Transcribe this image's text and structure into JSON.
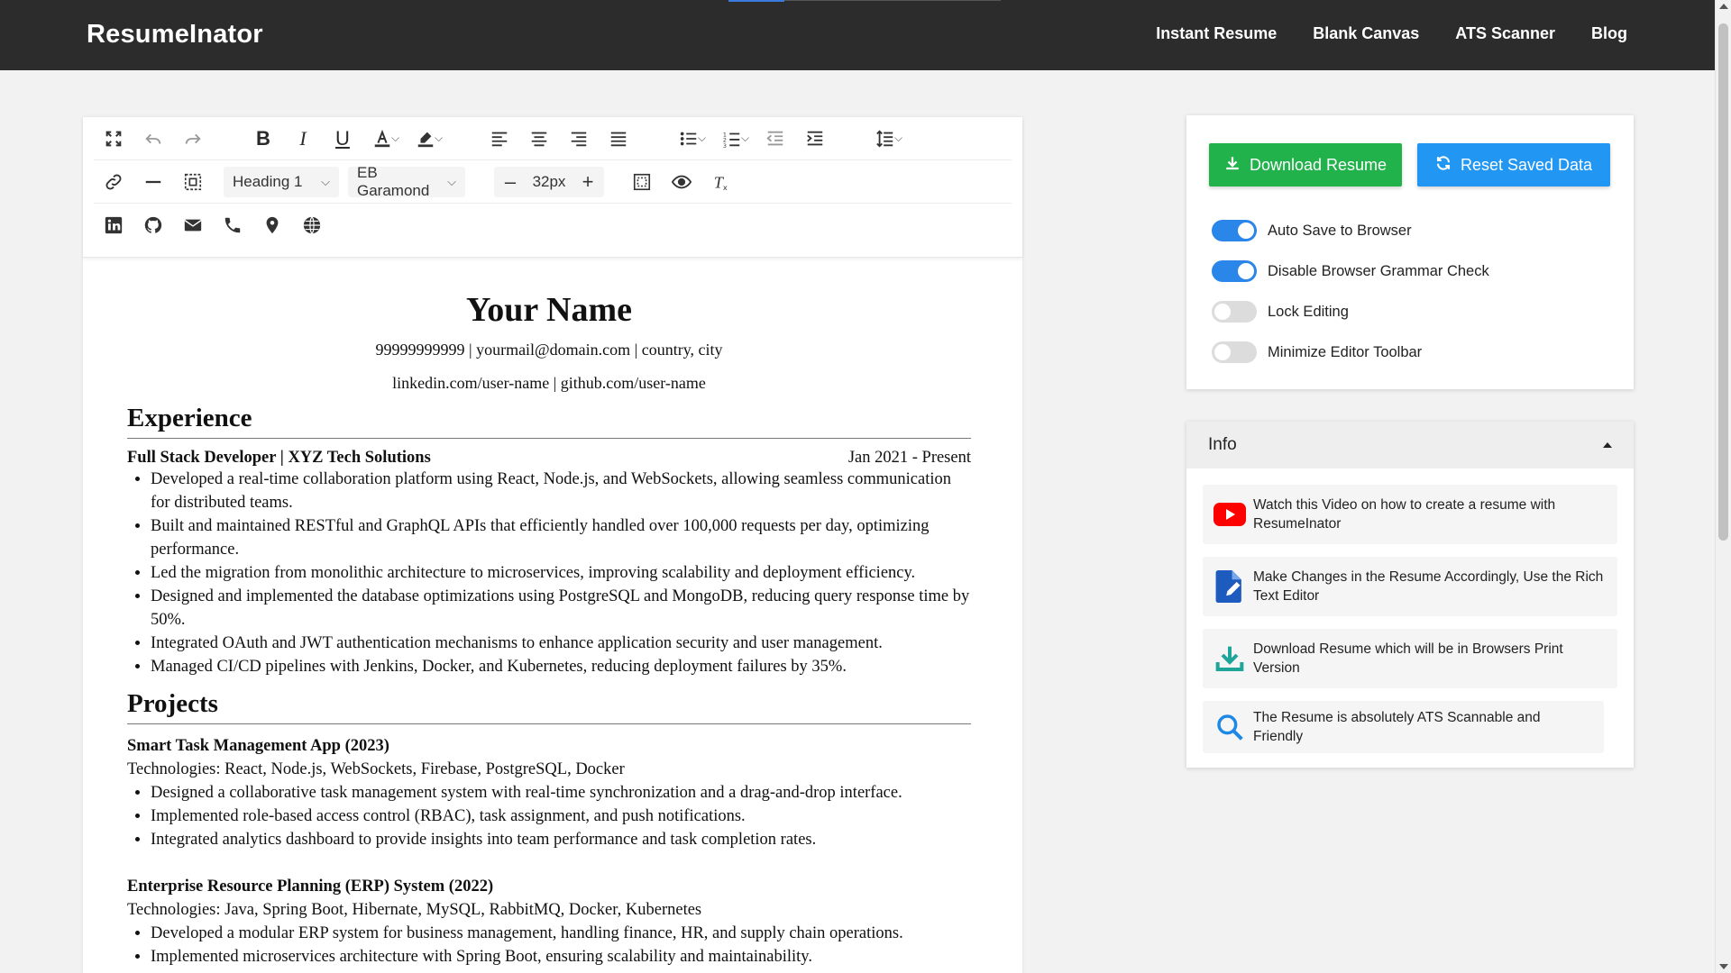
{
  "header": {
    "brand": "ResumeInator",
    "nav": [
      "Instant Resume",
      "Blank Canvas",
      "ATS Scanner",
      "Blog"
    ]
  },
  "toolbar": {
    "heading_select": "Heading 1",
    "font_select": "EB Garamond",
    "font_size": "32px",
    "minus": "–",
    "plus": "+"
  },
  "resume": {
    "name": "Your Name",
    "contact": "99999999999 | yourmail@domain.com | country, city",
    "links": "linkedin.com/user-name | github.com/user-name",
    "experience_heading": "Experience",
    "job_title": "Full Stack Developer | XYZ Tech Solutions",
    "job_dates": "Jan 2021 - Present",
    "job_bullets": [
      "Developed a real-time collaboration platform using React, Node.js, and WebSockets, allowing seamless communication for distributed teams.",
      "Built and maintained RESTful and GraphQL APIs that efficiently handled over 100,000 requests per day, optimizing performance.",
      "Led the migration from monolithic architecture to microservices, improving scalability and deployment efficiency.",
      "Designed and implemented the database optimizations using PostgreSQL and MongoDB, reducing query response time by 50%.",
      "Integrated OAuth and JWT authentication mechanisms to enhance application security and user management.",
      "Managed CI/CD pipelines with Jenkins, Docker, and Kubernetes, reducing deployment failures by 35%."
    ],
    "projects_heading": "Projects",
    "project1_title": "Smart Task Management App (2023)",
    "project1_tech": "Technologies: React, Node.js, WebSockets, Firebase, PostgreSQL, Docker",
    "project1_bullets": [
      "Designed a collaborative task management system with real-time synchronization and a drag-and-drop interface.",
      "Implemented role-based access control (RBAC), task assignment, and push notifications.",
      "Integrated analytics dashboard to provide insights into team performance and task completion rates."
    ],
    "project2_title": "Enterprise Resource Planning (ERP) System (2022)",
    "project2_tech": "Technologies: Java, Spring Boot, Hibernate, MySQL, RabbitMQ, Docker, Kubernetes",
    "project2_bullets": [
      "Developed a modular ERP system for business management, handling finance, HR, and supply chain operations.",
      "Implemented microservices architecture with Spring Boot, ensuring scalability and maintainability."
    ]
  },
  "controls": {
    "download_label": "Download Resume",
    "reset_label": "Reset Saved Data",
    "toggles": [
      {
        "label": "Auto Save to Browser",
        "on": true
      },
      {
        "label": "Disable Browser Grammar Check",
        "on": true
      },
      {
        "label": "Lock Editing",
        "on": false
      },
      {
        "label": "Minimize Editor Toolbar",
        "on": false
      }
    ]
  },
  "info": {
    "title": "Info",
    "cards": [
      {
        "icon": "youtube-icon",
        "text": "Watch this Video on how to create a resume with ResumeInator"
      },
      {
        "icon": "edit-document-icon",
        "text": "Make Changes in the Resume Accordingly, Use the Rich Text Editor"
      },
      {
        "icon": "download-icon",
        "text": "Download Resume which will be in Browsers Print Version"
      },
      {
        "icon": "search-icon",
        "text": "The Resume is absolutely ATS Scannable and Friendly"
      }
    ]
  },
  "colors": {
    "header_bg": "#2c2c2c",
    "download_green": "#22b24c",
    "reset_blue": "#2196f3",
    "toggle_on": "#2a86e8"
  }
}
